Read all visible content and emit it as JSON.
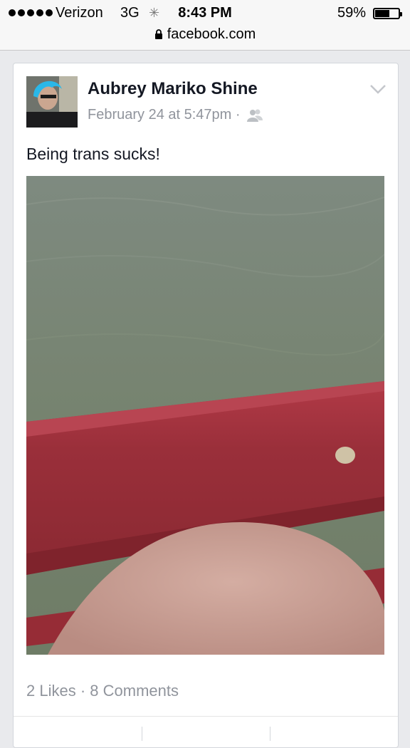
{
  "status_bar": {
    "carrier": "Verizon",
    "network": "3G",
    "time": "8:43 PM",
    "battery_percent": "59%",
    "battery_level": 0.59,
    "signal_dots": 5
  },
  "address_bar": {
    "url": "facebook.com",
    "icon": "lock-icon"
  },
  "post": {
    "author": "Aubrey Mariko Shine",
    "timestamp": "February 24 at 5:47pm ·",
    "audience_icon": "friends-icon",
    "menu_icon": "chevron-down-icon",
    "text": "Being trans sucks!",
    "likes": "2 Likes",
    "comments": "8 Comments",
    "stats_separator": "·"
  },
  "colors": {
    "water": "#7d8a7c",
    "railing": "#9e2e38",
    "skin": "#c9a196",
    "secondary_text": "#90949c"
  }
}
